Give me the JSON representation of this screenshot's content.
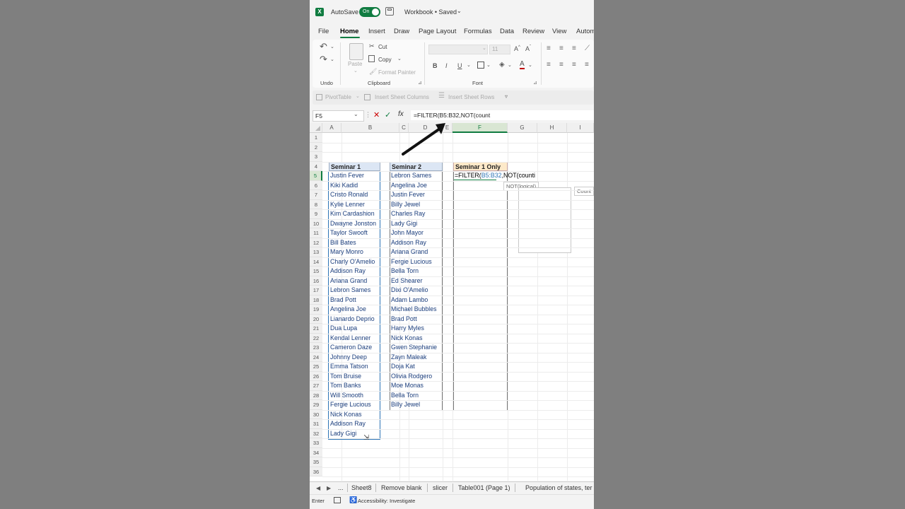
{
  "titlebar": {
    "autosave_label": "AutoSave",
    "toggle_label": "On",
    "workbook_title": "Workbook • Saved"
  },
  "menu": [
    "File",
    "Home",
    "Insert",
    "Draw",
    "Page Layout",
    "Formulas",
    "Data",
    "Review",
    "View",
    "Autom"
  ],
  "ribbon": {
    "cut": "Cut",
    "copy": "Copy",
    "paste": "Paste",
    "format_painter": "Format Painter",
    "font_size": "11",
    "groups": {
      "undo": "Undo",
      "clipboard": "Clipboard",
      "font": "Font"
    }
  },
  "toolbar2": {
    "pivot": "PivotTable",
    "insert_cols": "Insert Sheet Columns",
    "insert_rows": "Insert Sheet Rows"
  },
  "formula_bar": {
    "cell_ref": "F5",
    "formula": "=FILTER(B5:B32,NOT(count"
  },
  "columns": [
    "A",
    "B",
    "C",
    "D",
    "E",
    "F",
    "G",
    "H",
    "I"
  ],
  "rows": [
    "1",
    "2",
    "3",
    "4",
    "5",
    "6",
    "7",
    "8",
    "9",
    "10",
    "11",
    "12",
    "13",
    "14",
    "15",
    "16",
    "17",
    "18",
    "19",
    "20",
    "21",
    "22",
    "23",
    "24",
    "25",
    "26",
    "27",
    "28",
    "29",
    "30",
    "31",
    "32",
    "33",
    "34",
    "35",
    "36"
  ],
  "seminar1": {
    "header": "Seminar 1",
    "names": [
      "Justin Fever",
      "Kiki Kadid",
      "Cristo Ronald",
      "Kylie Lenner",
      "Kim Cardashion",
      "Dwayne Jonston",
      "Taylor Swooft",
      "Bill Bates",
      "Mary Monro",
      "Charly O'Amelio",
      "Addison Ray",
      "Ariana Grand",
      "Lebron Sames",
      "Brad Pott",
      "Angelina Joe",
      "Lianardo Deprio",
      "Dua Lupa",
      "Kendal Lenner",
      "Cameron Daze",
      "Johnny Deep",
      "Emma Tatson",
      "Tom Bruise",
      "Tom Banks",
      "Will Smooth",
      "Fergie Lucious",
      "Nick Konas",
      "Addison Ray",
      "Lady Gigi"
    ]
  },
  "seminar2": {
    "header": "Seminar 2",
    "names": [
      "Lebron Sames",
      "Angelina Joe",
      "Justin Fever",
      "Billy Jewel",
      "Charles Ray",
      "Lady Gigi",
      "John Mayor",
      "Addison Ray",
      "Ariana Grand",
      "Fergie Lucious",
      "Bella Torn",
      "Ed Shearer",
      "Dixi O'Amelio",
      "Adam Lambo",
      "Michael Bubbles",
      "Brad Pott",
      "Harry Myles",
      "Nick Konas",
      "Gwen Stephanie",
      "Zayn Maleak",
      "Doja Kat",
      "Olivia Rodgero",
      "Moe Monas",
      "Bella Torn",
      "Billy Jewel"
    ]
  },
  "seminar1_only": {
    "header": "Seminar 1 Only",
    "edit_prefix": "=FILTER(",
    "edit_ref": "B5:B32",
    "edit_suffix": ",NOT(counti",
    "tooltip": "NOT(logical)",
    "autocomplete_hint": "Count"
  },
  "sheet_tabs": [
    "Sheet8",
    "Remove blank",
    "slicer",
    "Table001 (Page 1)",
    "Population of states, ter"
  ],
  "tab_ellipsis": "...",
  "status": {
    "mode": "Enter",
    "accessibility": "Accessibility: Investigate"
  },
  "colors": {
    "excel_green": "#107c41",
    "header_blue": "#dce6f4",
    "header_orange": "#fde9c9",
    "selection_blue": "#2e75b6"
  }
}
